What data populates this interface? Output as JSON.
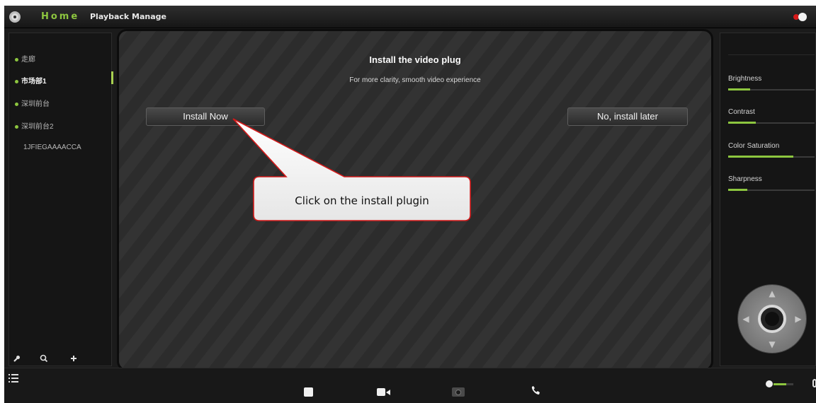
{
  "topbar": {
    "logo_icon": "app-logo-icon",
    "nav_home": "Home",
    "nav_playback": "Playback Manage",
    "accent_color": "#8dc63f"
  },
  "devices": [
    {
      "label": "走廊",
      "online": true,
      "selected": false
    },
    {
      "label": "市场部1",
      "online": true,
      "selected": true
    },
    {
      "label": "深圳前台",
      "online": true,
      "selected": false
    },
    {
      "label": "深圳前台2",
      "online": true,
      "selected": false
    },
    {
      "label": "1JFIEGAAAACCA",
      "online": false,
      "selected": false
    }
  ],
  "left_tools": [
    "wrench-icon",
    "zoom-in-icon",
    "plus-icon"
  ],
  "plugin": {
    "title": "Install the video plug",
    "subtitle": "For more clarity, smooth video experience",
    "install_now": "Install Now",
    "install_later": "No, install later"
  },
  "callout": {
    "text": "Click on the install plugin",
    "border_color": "#d31a1a"
  },
  "image_adjust": [
    {
      "label": "Brightness",
      "level": 0.25
    },
    {
      "label": "Contrast",
      "level": 0.32
    },
    {
      "label": "Color Saturation",
      "level": 0.75
    },
    {
      "label": "Sharpness",
      "level": 0.22
    }
  ],
  "ptz": {
    "icons": [
      "arrow-up-icon",
      "arrow-down-icon",
      "arrow-left-icon",
      "arrow-right-icon"
    ]
  },
  "bottombar": {
    "icons": [
      "menu-icon",
      "stop-icon",
      "record-icon",
      "snapshot-icon",
      "talk-icon",
      "volume-icon"
    ],
    "volume_level": 0.65
  }
}
